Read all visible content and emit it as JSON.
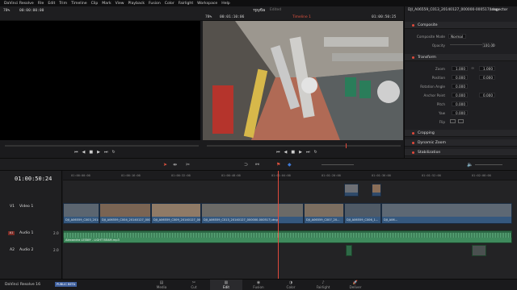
{
  "menu": [
    "DaVinci Resolve",
    "File",
    "Edit",
    "Trim",
    "Timeline",
    "Clip",
    "Mark",
    "View",
    "Playback",
    "Fusion",
    "Color",
    "Fairlight",
    "Workspace",
    "Help"
  ],
  "left_viewer": {
    "zoom": "78%",
    "timecode": "00:00:00:00"
  },
  "right_viewer": {
    "zoom": "78%",
    "timecode": "00:01:10:06",
    "project": "труба",
    "edited": "Edited",
    "timeline_name": "Timeline 1",
    "timecode_end": "01:00:50:25"
  },
  "clip_name": "DJI_A06559_C013_20140127_000000-000517).dng",
  "inspector": {
    "title": "Inspector",
    "composite": "Composite",
    "composite_mode_label": "Composite Mode",
    "composite_mode": "Normal",
    "opacity_label": "Opacity",
    "opacity": "100.00",
    "transform": "Transform",
    "zoom_label": "Zoom",
    "zoom_x": "1.000",
    "zoom_y": "1.000",
    "position_label": "Position",
    "pos_x": "0.000",
    "pos_y": "0.000",
    "rotation_label": "Rotation Angle",
    "rotation": "0.000",
    "anchor_label": "Anchor Point",
    "anchor_x": "0.000",
    "anchor_y": "0.000",
    "pitch_label": "Pitch",
    "pitch": "0.000",
    "yaw_label": "Yaw",
    "yaw": "0.000",
    "flip_label": "Flip",
    "cropping": "Cropping",
    "dynamic_zoom": "Dynamic Zoom",
    "stabilization": "Stabilization"
  },
  "timeline": {
    "timecode": "01:00:50:24",
    "ruler": [
      "01:00:00:00",
      "01:00:16:00",
      "01:00:32:00",
      "01:00:48:00",
      "01:01:04:00",
      "01:01:20:00",
      "01:01:36:00",
      "01:01:52:00",
      "01:02:08:00"
    ],
    "video_track": "Video 1",
    "video_tag": "V1",
    "audio1": "Audio 1",
    "audio1_tag": "A1",
    "audio2": "Audio 2",
    "audio2_tag": "A2",
    "audio_ch": "2.0",
    "audio_clip": "Alexandra LESNIY - LIGHT BEAM.mp3",
    "video_clips": [
      "DJI_A06559_C003_2014...",
      "DJI_A06559_C004_20140127_0000...",
      "DJI_A06559_C009_20140127_0000...",
      "DJI_A06559_C013_20140127_000000-000517).dng",
      "DJI_A06559_C007_20...",
      "DJI_A06559_C006_1...",
      "DJI_A06..."
    ]
  },
  "pages": [
    "Media",
    "Cut",
    "Edit",
    "Fusion",
    "Color",
    "Fairlight",
    "Deliver"
  ],
  "active_page": "Edit",
  "brand": "DaVinci Resolve 16",
  "beta": "PUBLIC BETA"
}
